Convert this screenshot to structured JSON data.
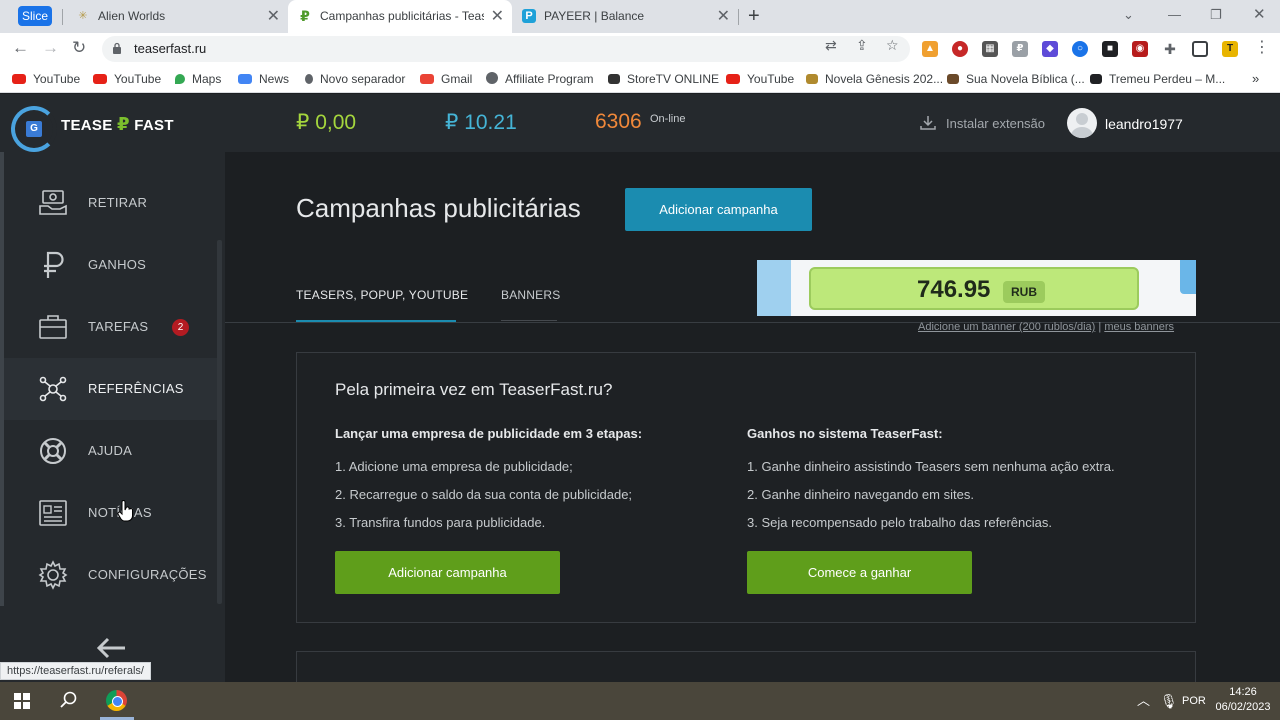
{
  "browser": {
    "slice_label": "Slice",
    "tabs": [
      {
        "label": "Alien Worlds",
        "active": false
      },
      {
        "label": "Campanhas publicitárias - Teaser",
        "active": true
      },
      {
        "label": "PAYEER | Balance",
        "active": false
      }
    ],
    "url": "teaserfast.ru",
    "bookmarks": [
      "YouTube",
      "YouTube",
      "Maps",
      "News",
      "Novo separador",
      "Gmail",
      "Affiliate Program",
      "StoreTV ONLINE",
      "YouTube",
      "Novela Gênesis 202...",
      "Sua Novela Bíblica (...",
      "Tremeu Perdeu – M..."
    ],
    "status_url": "https://teaserfast.ru/referals/"
  },
  "header": {
    "logo_text_left": "TEASE",
    "logo_text_mid": "₽",
    "logo_text_right": "FAST",
    "balance_primary": "₽ 0,00",
    "balance_secondary": "₽ 10.21",
    "online_count": "6306",
    "online_label": "On-line",
    "install_label": "Instalar extensão",
    "username": "leandro1977"
  },
  "sidebar": {
    "items": [
      {
        "label": "RETIRAR",
        "icon": "withdraw-icon"
      },
      {
        "label": "GANHOS",
        "icon": "ruble-icon"
      },
      {
        "label": "TAREFAS",
        "icon": "briefcase-icon",
        "badge": "2"
      },
      {
        "label": "REFERÊNCIAS",
        "icon": "network-icon"
      },
      {
        "label": "AJUDA",
        "icon": "lifebuoy-icon"
      },
      {
        "label": "NOTÍCIAS",
        "icon": "newspaper-icon"
      },
      {
        "label": "CONFIGURAÇÕES",
        "icon": "gear-icon"
      }
    ]
  },
  "main": {
    "title": "Campanhas publicitárias",
    "add_campaign": "Adicionar campanha",
    "tabs": [
      "TEASERS, POPUP, YOUTUBE",
      "BANNERS"
    ],
    "banner": {
      "amount": "746.95",
      "currency": "RUB"
    },
    "banner_link_add": "Adicione um banner (200 rublos/dia)",
    "banner_link_sep": " | ",
    "banner_link_mine": "meus banners",
    "card": {
      "title": "Pela primeira vez em TeaserFast.ru?",
      "left_heading": "Lançar uma empresa de publicidade em 3 etapas:",
      "left_steps": [
        "1. Adicione uma empresa de publicidade;",
        "2. Recarregue o saldo da sua conta de publicidade;",
        "3. Transfira fundos para publicidade."
      ],
      "left_button": "Adicionar campanha",
      "right_heading": "Ganhos no sistema TeaserFast:",
      "right_steps": [
        "1. Ganhe dinheiro assistindo Teasers sem nenhuma ação extra.",
        "2. Ganhe dinheiro navegando em sites.",
        "3. Seja recompensado pelo trabalho das referências."
      ],
      "right_button": "Comece a ganhar"
    }
  },
  "taskbar": {
    "language": "POR",
    "time": "14:26",
    "date": "06/02/2023"
  },
  "colors": {
    "accent_blue": "#1b8cb0",
    "accent_green": "#5f9e1b",
    "balance_green": "#a5d63d",
    "balance_blue": "#45b4d6",
    "online_orange": "#f0883a"
  }
}
